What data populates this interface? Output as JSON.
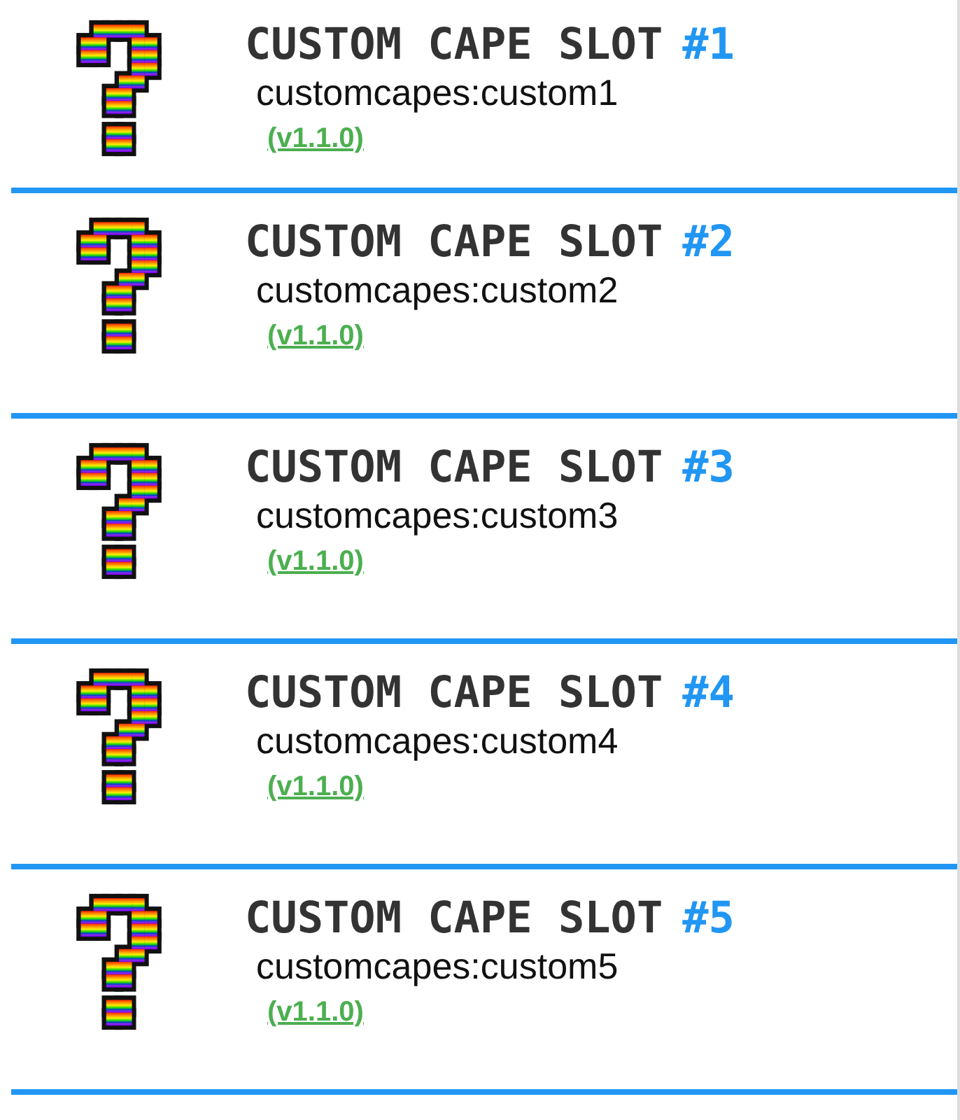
{
  "slots": [
    {
      "title": "CUSTOM CAPE SLOT",
      "number": "#1",
      "id": "customcapes:custom1",
      "version": "(v1.1.0)"
    },
    {
      "title": "CUSTOM CAPE SLOT",
      "number": "#2",
      "id": "customcapes:custom2",
      "version": "(v1.1.0)"
    },
    {
      "title": "CUSTOM CAPE SLOT",
      "number": "#3",
      "id": "customcapes:custom3",
      "version": "(v1.1.0)"
    },
    {
      "title": "CUSTOM CAPE SLOT",
      "number": "#4",
      "id": "customcapes:custom4",
      "version": "(v1.1.0)"
    },
    {
      "title": "CUSTOM CAPE SLOT",
      "number": "#5",
      "id": "customcapes:custom5",
      "version": "(v1.1.0)"
    }
  ]
}
